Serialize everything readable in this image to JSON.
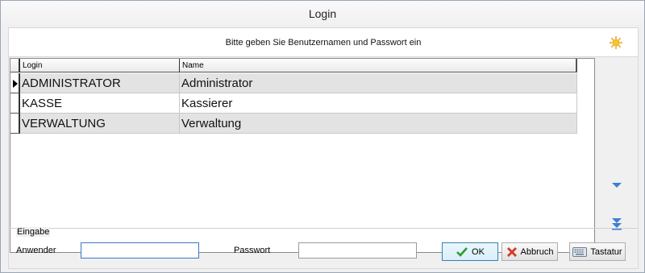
{
  "window": {
    "title": "Login"
  },
  "header": {
    "instruction": "Bitte geben Sie Benutzernamen und Passwort ein",
    "icon": "sun-icon"
  },
  "grid": {
    "columns": [
      "Login",
      "Name"
    ],
    "rows": [
      {
        "login": "ADMINISTRATOR",
        "name": "Administrator",
        "selected": true
      },
      {
        "login": "KASSE",
        "name": "Kassierer",
        "selected": false
      },
      {
        "login": "VERWALTUNG",
        "name": "Verwaltung",
        "selected": false
      }
    ]
  },
  "navigation": {
    "next_icon": "triangle-down-icon",
    "last_icon": "double-chevron-down-icon"
  },
  "input_group": {
    "legend": "Eingabe",
    "user_label": "Anwender",
    "user_value": "",
    "password_label": "Passwort",
    "password_value": ""
  },
  "buttons": {
    "ok_label": "OK",
    "cancel_label": "Abbruch",
    "keyboard_label": "Tastatur"
  },
  "colors": {
    "accent": "#3a78c8",
    "ok_check": "#2e9b2e",
    "cancel_x": "#d33a2a",
    "row_alt": "#e3e3e3"
  }
}
